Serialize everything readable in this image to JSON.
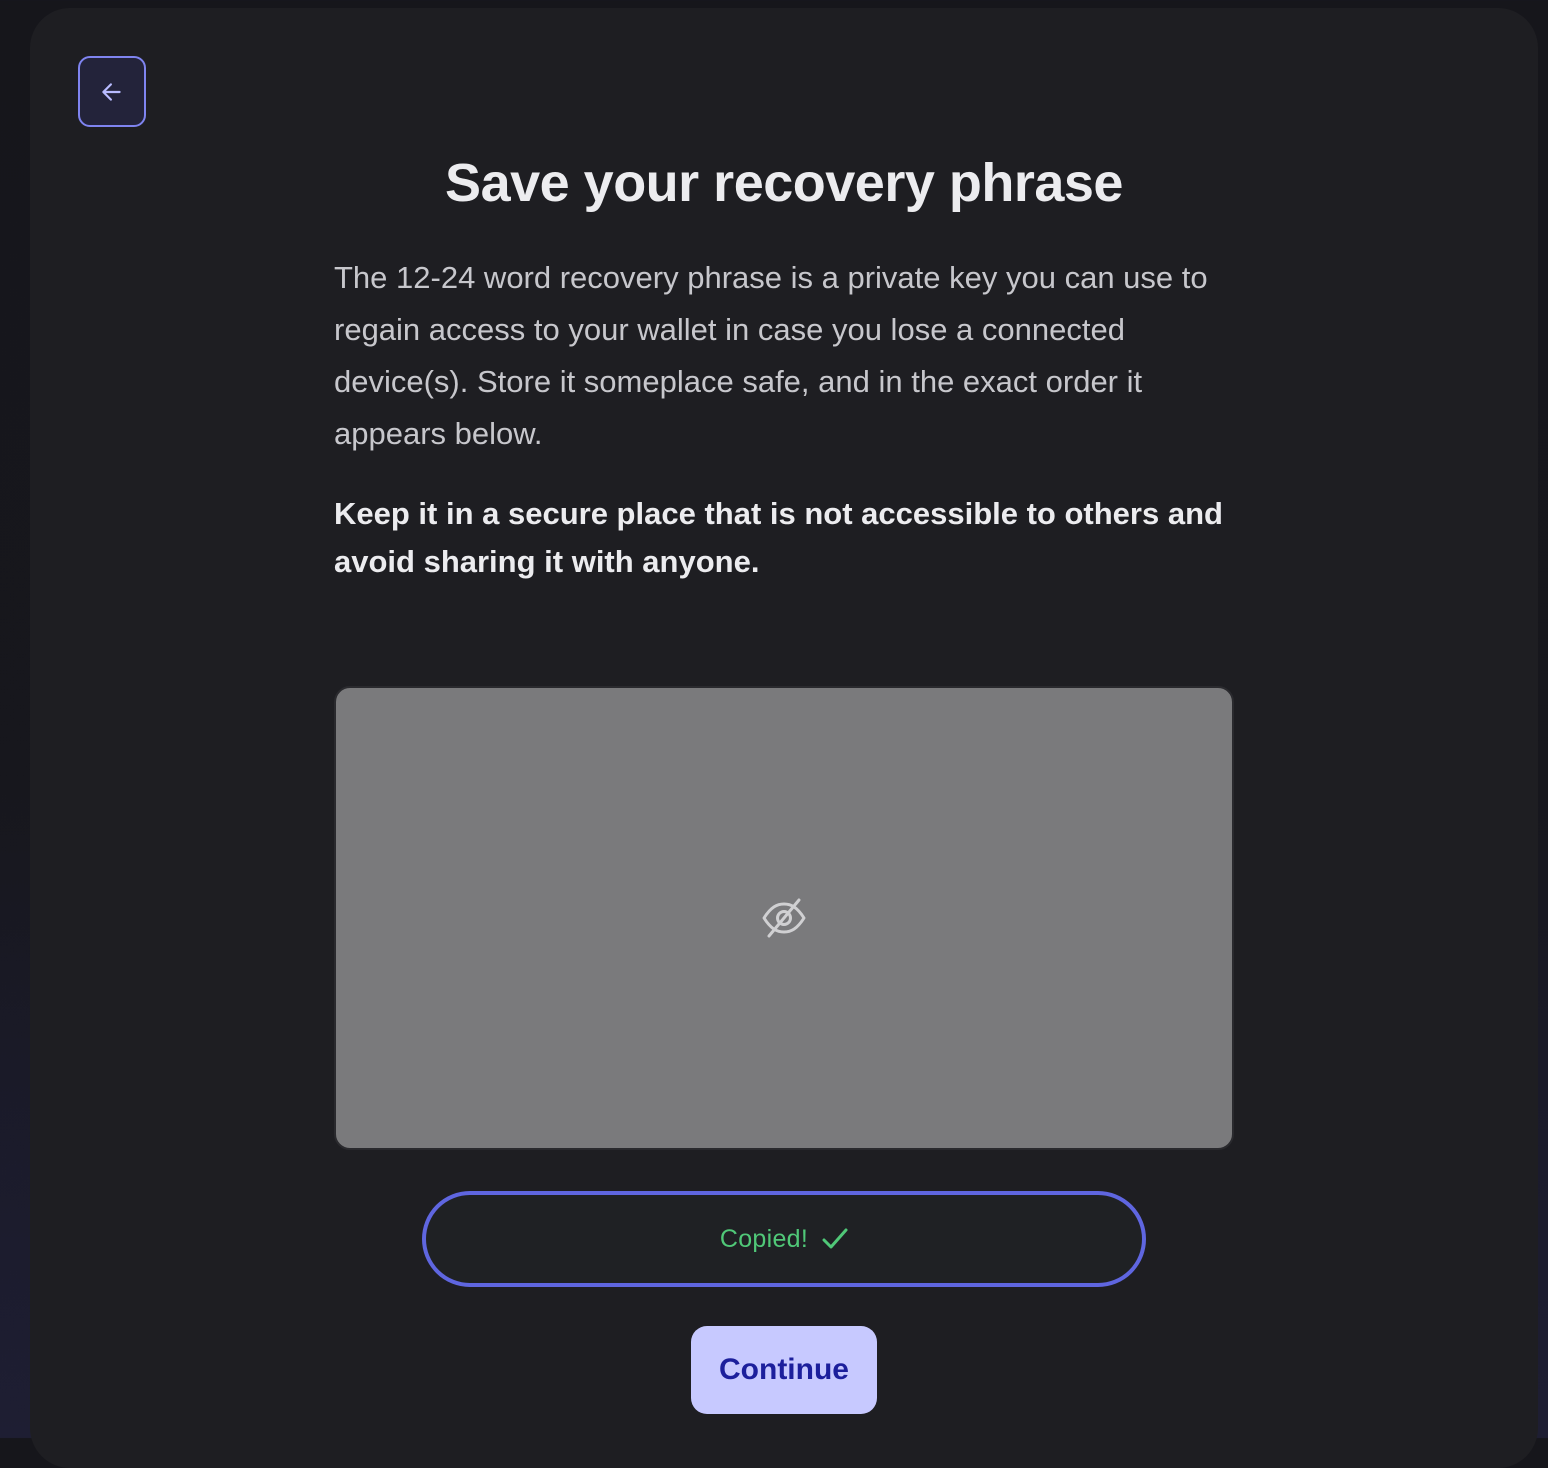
{
  "page": {
    "title": "Save your recovery phrase",
    "description": "The 12-24 word recovery phrase is a private key you can use to regain access to your wallet in case you lose a connected device(s). Store it someplace safe, and in the exact order it appears below.",
    "warning": "Keep it in a secure place that is not accessible to others and avoid sharing it with anyone."
  },
  "back_button": {
    "icon": "arrow-left-icon"
  },
  "phrase_box": {
    "state": "hidden",
    "reveal_icon": "eye-off-icon",
    "words": [
      "",
      "",
      "",
      "",
      "",
      "",
      "",
      "",
      "",
      "",
      "",
      ""
    ]
  },
  "copy_button": {
    "label": "Copied!",
    "icon": "check-icon",
    "label_color": "#50c878",
    "border_color": "#5f66e0"
  },
  "continue_button": {
    "label": "Continue",
    "background": "#c7c9ff",
    "text_color": "#1c1f9c"
  },
  "accent_color": "#7f84f0"
}
